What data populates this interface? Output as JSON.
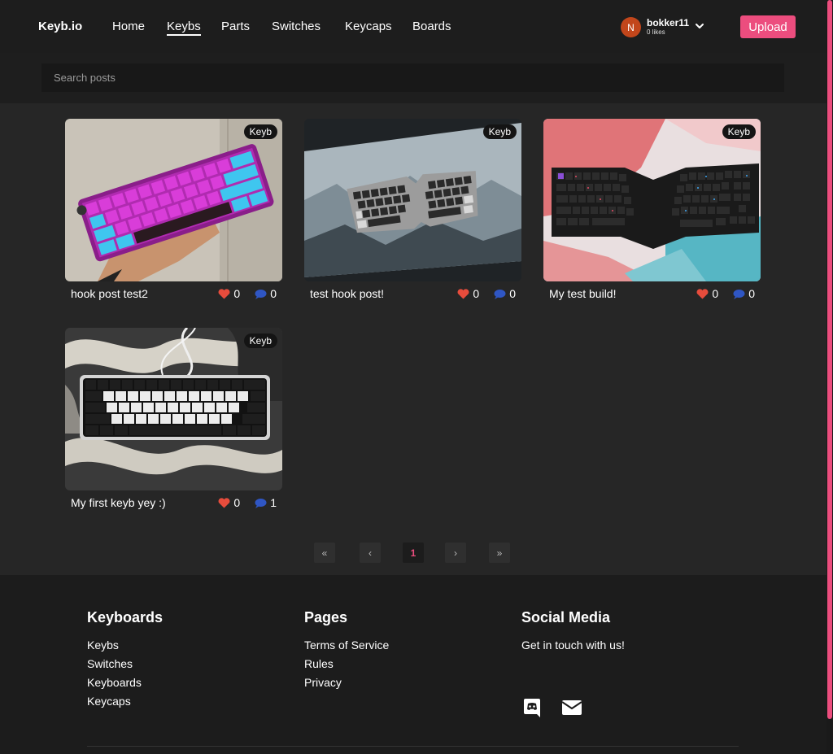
{
  "nav": {
    "brand": "Keyb.io",
    "links": [
      "Home",
      "Keybs",
      "Parts",
      "Switches",
      "Keycaps",
      "Boards"
    ],
    "active": "Keybs",
    "user": {
      "initial": "N",
      "name": "bokker11",
      "likes": "0 likes"
    },
    "upload_label": "Upload"
  },
  "search": {
    "placeholder": "Search posts"
  },
  "posts": [
    {
      "title": "hook post test2",
      "tag": "Keyb",
      "likes": "0",
      "comments": "0"
    },
    {
      "title": "test hook post!",
      "tag": "Keyb",
      "likes": "0",
      "comments": "0"
    },
    {
      "title": "My test build!",
      "tag": "Keyb",
      "likes": "0",
      "comments": "0"
    },
    {
      "title": "My first keyb yey :)",
      "tag": "Keyb",
      "likes": "0",
      "comments": "1"
    }
  ],
  "pagination": {
    "first": "«",
    "prev": "‹",
    "current": "1",
    "next": "›",
    "last": "»"
  },
  "footer": {
    "keyboards": {
      "heading": "Keyboards",
      "links": [
        "Keybs",
        "Switches",
        "Keyboards",
        "Keycaps"
      ]
    },
    "pages": {
      "heading": "Pages",
      "links": [
        "Terms of Service",
        "Rules",
        "Privacy"
      ]
    },
    "social": {
      "heading": "Social Media",
      "text": "Get in touch with us!",
      "icons": [
        "discord-icon",
        "mail-icon"
      ]
    }
  },
  "colors": {
    "accent": "#ec4d7e",
    "heart": "#e74c3c",
    "comment": "#2f56c4"
  }
}
